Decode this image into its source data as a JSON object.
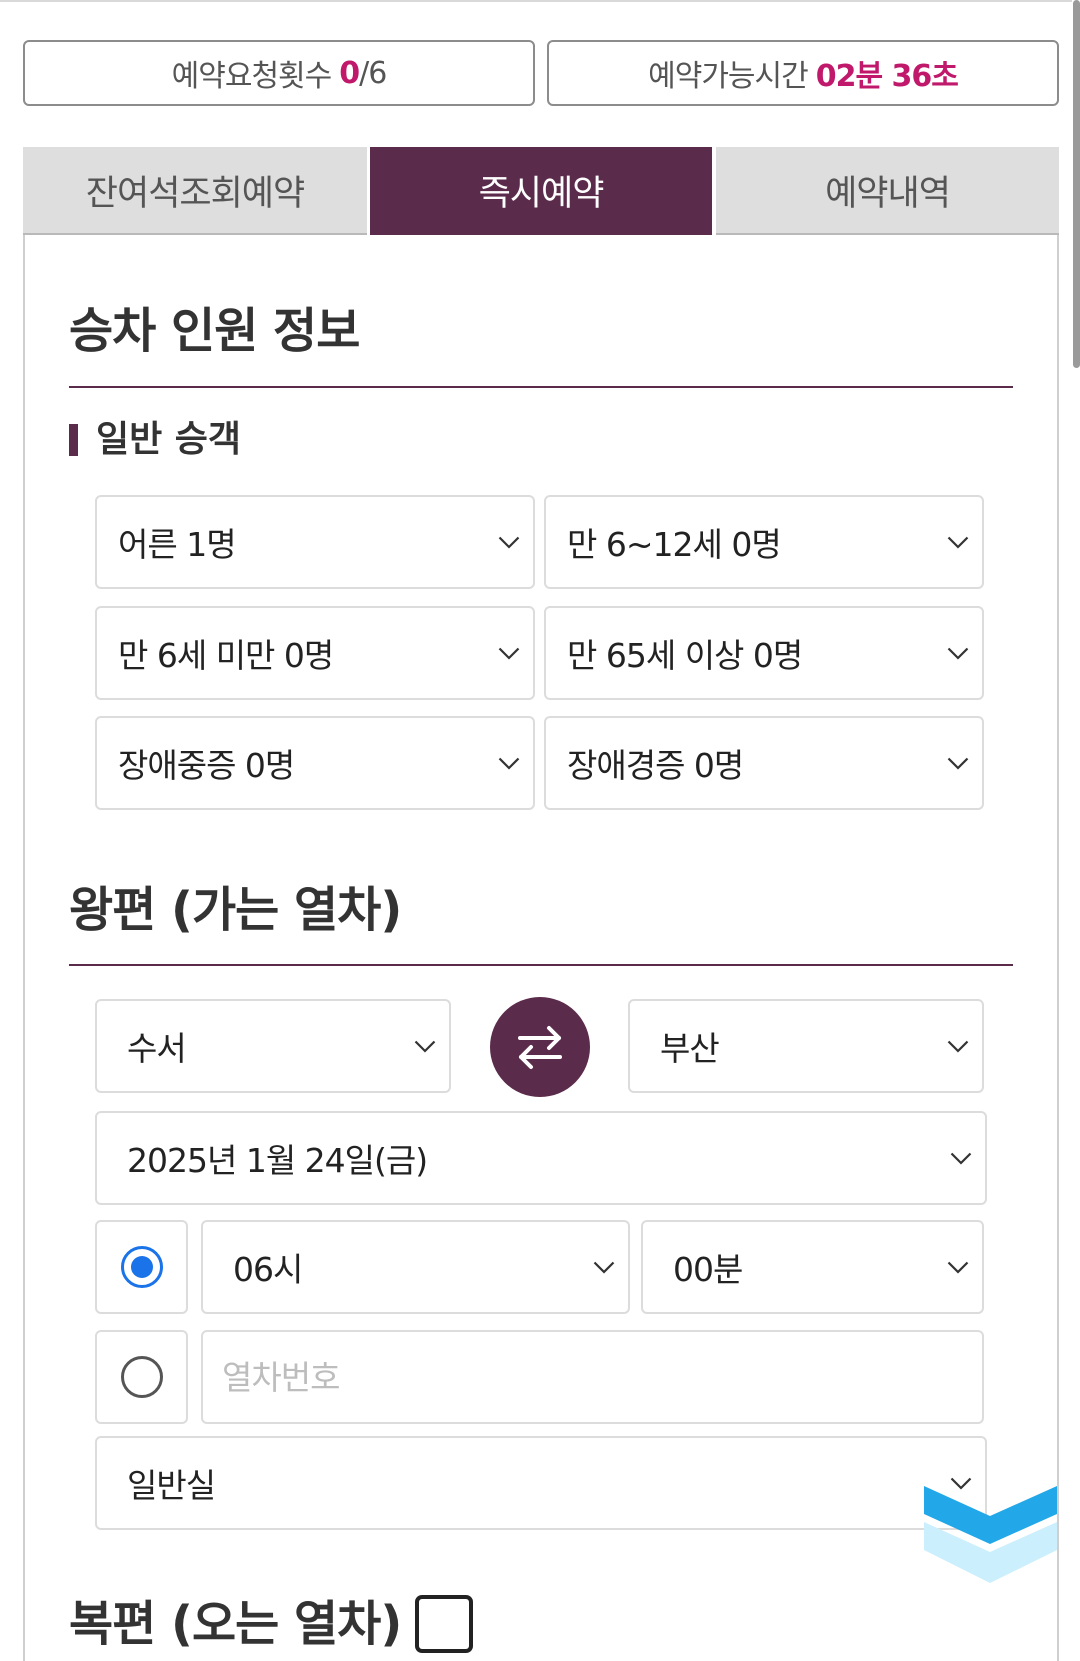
{
  "status": {
    "request_label": "예약요청횟수",
    "request_used": "0",
    "request_max": "/6",
    "time_label": "예약가능시간",
    "time_remaining": "02분 36초"
  },
  "tabs": [
    {
      "label": "잔여석조회예약",
      "active": false
    },
    {
      "label": "즉시예약",
      "active": true
    },
    {
      "label": "예약내역",
      "active": false
    }
  ],
  "passengers": {
    "title": "승차 인원 정보",
    "group_label": "일반 승객",
    "adult": "어른 1명",
    "child_6_12": "만 6~12세 0명",
    "child_under_6": "만 6세 미만 0명",
    "senior_65": "만 65세 이상 0명",
    "disabled_severe": "장애중증 0명",
    "disabled_mild": "장애경증 0명"
  },
  "outbound": {
    "title": "왕편 (가는 열차)",
    "departure": "수서",
    "arrival": "부산",
    "date": "2025년 1월 24일(금)",
    "search_by_time": true,
    "hour": "06시",
    "minute": "00분",
    "search_by_train_number": false,
    "train_number_value": "",
    "train_number_placeholder": "열차번호",
    "seat_class": "일반실"
  },
  "return_trip": {
    "title": "복편 (오는 열차)",
    "checked": false
  },
  "icons": {
    "select_arrow": "chevron-down-icon",
    "swap": "swap-arrows-icon",
    "scroll_hint": "double-chevron-down-icon"
  },
  "colors": {
    "accent": "#5b2b4b",
    "highlight": "#c0196b",
    "radio": "#1a73e8",
    "scroll_hint": "#22a7e8",
    "scroll_hint_pale": "#cbeffc"
  }
}
